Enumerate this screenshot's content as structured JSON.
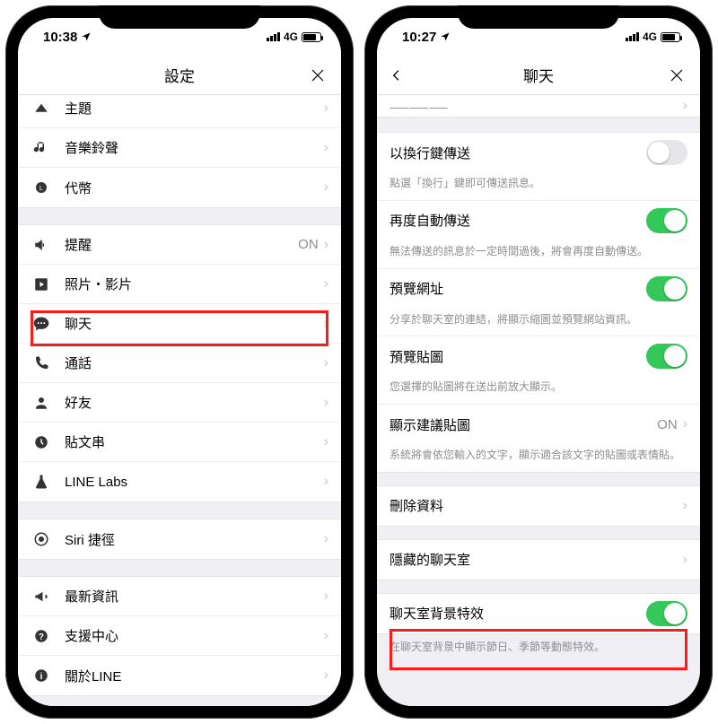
{
  "left": {
    "status": {
      "time": "10:38",
      "network": "4G"
    },
    "nav": {
      "title": "設定"
    },
    "rows": {
      "theme": "主題",
      "ringtone": "音樂鈴聲",
      "coin": "代幣",
      "notify": "提醒",
      "notify_value": "ON",
      "media": "照片・影片",
      "chat": "聊天",
      "call": "通話",
      "friends": "好友",
      "timeline": "貼文串",
      "labs": "LINE Labs",
      "siri": "Siri 捷徑",
      "news": "最新資訊",
      "help": "支援中心",
      "about": "關於LINE"
    }
  },
  "right": {
    "status": {
      "time": "10:27",
      "network": "4G"
    },
    "nav": {
      "title": "聊天"
    },
    "items": {
      "backup_partial": "備份聊天記錄",
      "enter_send": "以換行鍵傳送",
      "enter_send_sub": "點選「換行」鍵即可傳送訊息。",
      "resend": "再度自動傳送",
      "resend_sub": "無法傳送的訊息於一定時間過後，將會再度自動傳送。",
      "preview_url": "預覽網址",
      "preview_url_sub": "分享於聊天室的連結，將顯示縮圖並預覽網站資訊。",
      "preview_sticker": "預覽貼圖",
      "preview_sticker_sub": "您選擇的貼圖將在送出前放大顯示。",
      "suggest": "顯示建議貼圖",
      "suggest_value": "ON",
      "suggest_sub": "系統將會依您輸入的文字，顯示適合該文字的貼圖或表情貼。",
      "delete": "刪除資料",
      "hidden": "隱藏的聊天室",
      "bgfx": "聊天室背景特效",
      "bgfx_sub": "在聊天室背景中顯示節日、季節等動態特效。"
    },
    "toggles": {
      "enter_send": false,
      "resend": true,
      "preview_url": true,
      "preview_sticker": true,
      "bgfx": true
    }
  }
}
